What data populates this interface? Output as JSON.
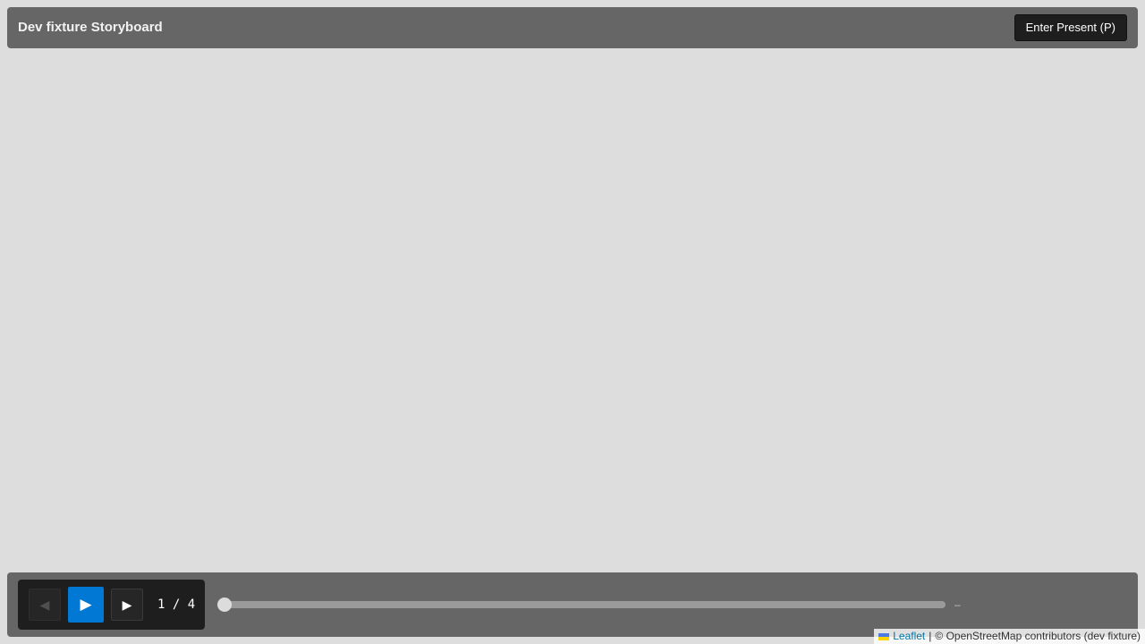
{
  "header": {
    "title": "Dev fixture Storyboard",
    "present_button": "Enter Present (P)"
  },
  "controls": {
    "prev_icon": "◀",
    "play_icon": "▶",
    "next_icon": "▶",
    "current_slide": 1,
    "total_slides": 4,
    "counter_text": "1 / 4",
    "progress_fraction": 0,
    "time_label": "–"
  },
  "attribution": {
    "leaflet_label": "Leaflet",
    "separator": "|",
    "copyright": "© OpenStreetMap contributors (dev fixture)"
  },
  "colors": {
    "accent": "#0078d4",
    "panel": "#666666",
    "map_background": "#dddddd"
  },
  "icons": {
    "prev": "triangle-left-icon",
    "play": "play-icon",
    "next": "triangle-right-icon",
    "flag": "ukraine-flag-icon"
  }
}
